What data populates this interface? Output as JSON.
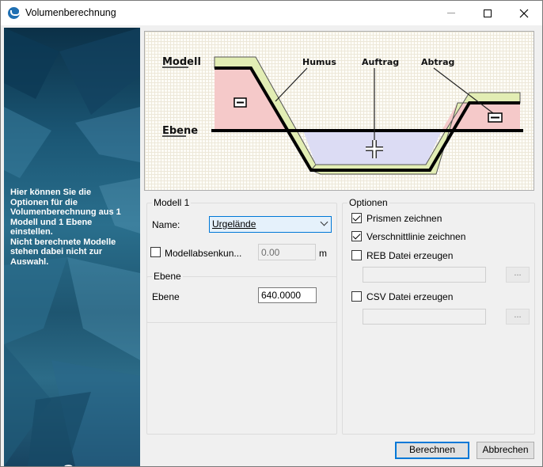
{
  "window": {
    "title": "Volumenberechnung"
  },
  "left_panel": {
    "info_text": "Hier können Sie die\nOptionen für die\nVolumenberechnung aus 1\nModell und 1 Ebene\neinstellen.\nNicht berechnete Modelle\nstehen dabei nicht zur\nAuswahl.",
    "help_glyph": "?"
  },
  "illustration": {
    "modell_label": "Modell",
    "ebene_label": "Ebene",
    "humus_label": "Humus",
    "auftrag_label": "Auftrag",
    "abtrag_label": "Abtrag",
    "colors": {
      "cut": "#f5c9c9",
      "fill": "#dcdcf4",
      "humus": "#e2edb4"
    }
  },
  "modell_group": {
    "legend": "Modell 1",
    "name_label": "Name:",
    "name_value": "Urgelände",
    "absenkung_label": "Modellabsenkun...",
    "absenkung_checked": false,
    "absenkung_value": "0.00",
    "absenkung_unit": "m"
  },
  "ebene_group": {
    "legend": "Ebene",
    "ebene_label": "Ebene",
    "ebene_value": "640.0000"
  },
  "optionen_group": {
    "legend": "Optionen",
    "prismen_label": "Prismen zeichnen",
    "prismen_checked": true,
    "verschnitt_label": "Verschnittlinie zeichnen",
    "verschnitt_checked": true,
    "reb_label": "REB Datei erzeugen",
    "reb_checked": false,
    "reb_path": "",
    "csv_label": "CSV Datei erzeugen",
    "csv_checked": false,
    "csv_path": "",
    "browse_label": "..."
  },
  "buttons": {
    "berechnen": "Berechnen",
    "abbrechen": "Abbrechen"
  }
}
